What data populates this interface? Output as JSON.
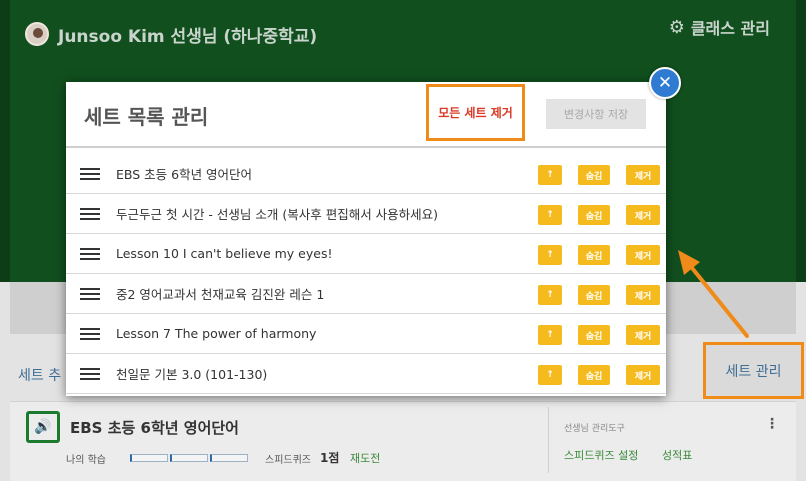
{
  "header": {
    "teacher": "Junsoo Kim 선생님  (하나중학교)",
    "class_management": "클래스 관리"
  },
  "page": {
    "set_add": "세트 추",
    "set_management": "세트 관리"
  },
  "card": {
    "title": "EBS 초등 6학년 영어단어",
    "my_learning": "나의 학습",
    "speed_quiz": "스피드퀴즈",
    "score": "1점",
    "retry": "재도전",
    "tools_label": "선생님 관리도구",
    "quiz_setting": "스피드퀴즈 설정",
    "report": "성적표"
  },
  "modal": {
    "title": "세트 목록 관리",
    "remove_all": "모든 세트 제거",
    "save": "변경사항 저장",
    "up_label": "↑",
    "hide_label": "숨김",
    "remove_label": "제거",
    "sets": [
      "EBS 초등 6학년 영어단어",
      "두근두근 첫 시간 - 선생님 소개 (복사후 편집해서 사용하세요)",
      "Lesson 10 I can't believe my eyes!",
      "중2 영어교과서 천재교육 김진완 레슨 1",
      "Lesson 7 The power of harmony",
      "천일문 기본 3.0 (101-130)"
    ]
  },
  "colors": {
    "header_green": "#114f1e",
    "accent_orange": "#f08a18",
    "button_yellow": "#f5bb1e",
    "close_blue": "#2f7bd1",
    "link_blue": "#3f6e93",
    "danger_red": "#d83a25"
  },
  "icons": [
    "avatar",
    "gear-icon",
    "close-icon",
    "hamburger-icon",
    "speaker-icon",
    "kebab-icon",
    "arrow-up-icon"
  ]
}
